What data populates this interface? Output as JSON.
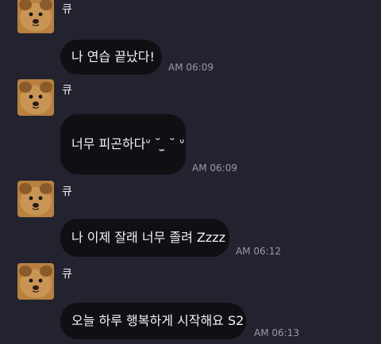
{
  "chat": {
    "messages": [
      {
        "sender": "큐",
        "text": "나 연습 끝났다!",
        "time": "AM 06:09"
      },
      {
        "sender": "큐",
        "text": "너무 피곤하다ᐡ ˘ ̫ ˘ ᐡ",
        "time": "AM 06:09"
      },
      {
        "sender": "큐",
        "text": "나 이제 잘래 너무 졸려 Zzzz",
        "time": "AM 06:12"
      },
      {
        "sender": "큐",
        "text": "오늘 하루 행복하게 시작해요 S2",
        "time": "AM 06:13"
      }
    ]
  }
}
